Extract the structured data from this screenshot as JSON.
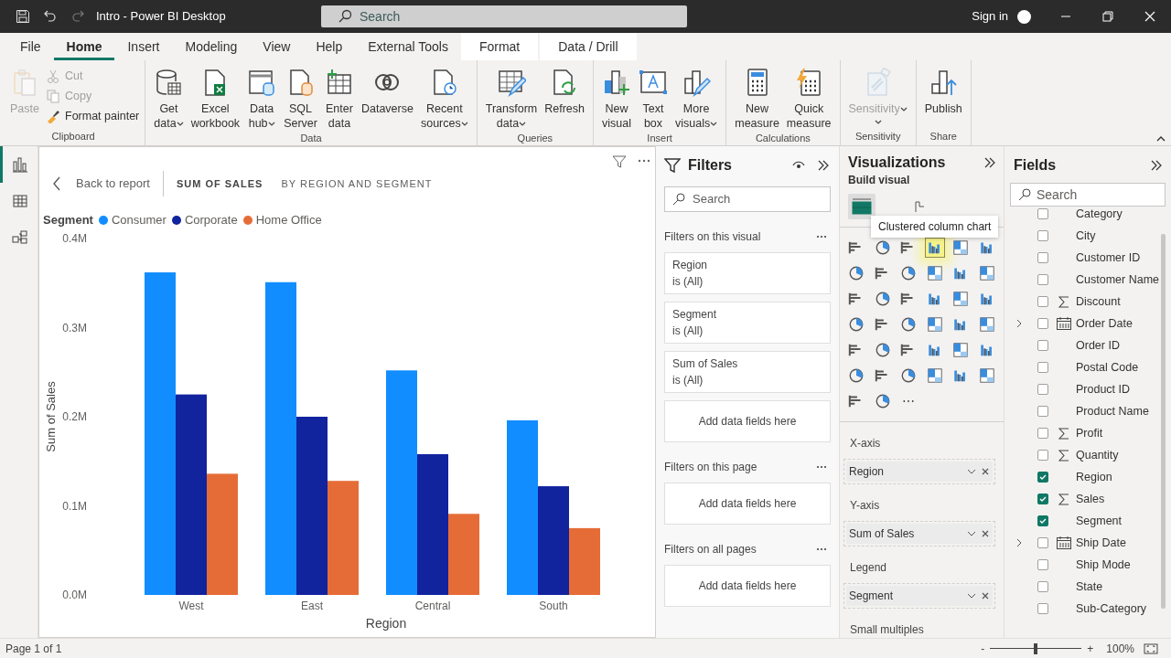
{
  "window": {
    "title": "Intro - Power BI Desktop",
    "search_placeholder": "Search",
    "sign_in": "Sign in"
  },
  "menu_tabs": [
    {
      "label": "File",
      "selected": false,
      "kind": "plain"
    },
    {
      "label": "Home",
      "selected": true,
      "kind": "plain"
    },
    {
      "label": "Insert",
      "selected": false,
      "kind": "plain"
    },
    {
      "label": "Modeling",
      "selected": false,
      "kind": "plain"
    },
    {
      "label": "View",
      "selected": false,
      "kind": "plain"
    },
    {
      "label": "Help",
      "selected": false,
      "kind": "plain"
    },
    {
      "label": "External Tools",
      "selected": false,
      "kind": "plain"
    },
    {
      "label": "Format",
      "selected": false,
      "kind": "contextual"
    },
    {
      "label": "Data / Drill",
      "selected": false,
      "kind": "contextual"
    }
  ],
  "ribbon": {
    "groups": [
      {
        "label": "Clipboard",
        "buttons": [
          {
            "lines": [
              "Paste"
            ],
            "kind": "large",
            "disabled": true,
            "dropdown": false
          },
          {
            "lines": [
              "Cut"
            ],
            "kind": "small",
            "disabled": true
          },
          {
            "lines": [
              "Copy"
            ],
            "kind": "small",
            "disabled": true
          },
          {
            "lines": [
              "Format painter"
            ],
            "kind": "small",
            "disabled": false
          }
        ]
      },
      {
        "label": "Data",
        "buttons": [
          {
            "lines": [
              "Get",
              "data"
            ],
            "kind": "large",
            "disabled": false,
            "dropdown": true
          },
          {
            "lines": [
              "Excel",
              "workbook"
            ],
            "kind": "large",
            "disabled": false,
            "dropdown": false
          },
          {
            "lines": [
              "Data",
              "hub"
            ],
            "kind": "large",
            "disabled": false,
            "dropdown": true
          },
          {
            "lines": [
              "SQL",
              "Server"
            ],
            "kind": "large",
            "disabled": false,
            "dropdown": false
          },
          {
            "lines": [
              "Enter",
              "data"
            ],
            "kind": "large",
            "disabled": false,
            "dropdown": false
          },
          {
            "lines": [
              "Dataverse"
            ],
            "kind": "large",
            "disabled": false,
            "dropdown": false
          },
          {
            "lines": [
              "Recent",
              "sources"
            ],
            "kind": "large",
            "disabled": false,
            "dropdown": true
          }
        ]
      },
      {
        "label": "Queries",
        "buttons": [
          {
            "lines": [
              "Transform",
              "data"
            ],
            "kind": "large",
            "disabled": false,
            "dropdown": true
          },
          {
            "lines": [
              "Refresh"
            ],
            "kind": "large",
            "disabled": false,
            "dropdown": false
          }
        ]
      },
      {
        "label": "Insert",
        "buttons": [
          {
            "lines": [
              "New",
              "visual"
            ],
            "kind": "large",
            "disabled": false,
            "dropdown": false
          },
          {
            "lines": [
              "Text",
              "box"
            ],
            "kind": "large",
            "disabled": false,
            "dropdown": false
          },
          {
            "lines": [
              "More",
              "visuals"
            ],
            "kind": "large",
            "disabled": false,
            "dropdown": true
          }
        ]
      },
      {
        "label": "Calculations",
        "buttons": [
          {
            "lines": [
              "New",
              "measure"
            ],
            "kind": "large",
            "disabled": false,
            "dropdown": false
          },
          {
            "lines": [
              "Quick",
              "measure"
            ],
            "kind": "large",
            "disabled": false,
            "dropdown": false
          }
        ]
      },
      {
        "label": "Sensitivity",
        "buttons": [
          {
            "lines": [
              "Sensitivity"
            ],
            "kind": "large",
            "disabled": true,
            "dropdown": true
          }
        ]
      },
      {
        "label": "Share",
        "buttons": [
          {
            "lines": [
              "Publish"
            ],
            "kind": "large",
            "disabled": false,
            "dropdown": false
          }
        ]
      }
    ]
  },
  "left_nav": [
    {
      "selected": true
    },
    {
      "selected": false
    },
    {
      "selected": false
    }
  ],
  "visual_header": {
    "back": "Back to report",
    "title": "SUM OF SALES",
    "subtitle": "BY REGION AND SEGMENT"
  },
  "chart": {
    "legend_title": "Segment",
    "chart_data": {
      "type": "bar",
      "xlabel": "Region",
      "ylabel": "Sum of Sales",
      "categories": [
        "West",
        "East",
        "Central",
        "South"
      ],
      "series": [
        {
          "name": "Consumer",
          "color": "#118dff",
          "values": [
            362000,
            351000,
            252000,
            196000
          ]
        },
        {
          "name": "Corporate",
          "color": "#12239e",
          "values": [
            225000,
            200000,
            158000,
            122000
          ]
        },
        {
          "name": "Home Office",
          "color": "#e66c37",
          "values": [
            136000,
            128000,
            91000,
            75000
          ]
        }
      ],
      "ylim": [
        0,
        400000
      ],
      "yticks": [
        {
          "value": 0,
          "label": "0.0M"
        },
        {
          "value": 100000,
          "label": "0.1M"
        },
        {
          "value": 200000,
          "label": "0.2M"
        },
        {
          "value": 300000,
          "label": "0.3M"
        },
        {
          "value": 400000,
          "label": "0.4M"
        }
      ]
    }
  },
  "filters": {
    "title": "Filters",
    "search_placeholder": "Search",
    "sections": [
      {
        "label": "Filters on this visual",
        "cards": [
          {
            "field": "Region",
            "state": "is (All)"
          },
          {
            "field": "Segment",
            "state": "is (All)"
          },
          {
            "field": "Sum of Sales",
            "state": "is (All)"
          }
        ],
        "drop": "Add data fields here"
      },
      {
        "label": "Filters on this page",
        "drop": "Add data fields here"
      },
      {
        "label": "Filters on all pages",
        "drop": "Add data fields here"
      }
    ]
  },
  "visualizations": {
    "title": "Visualizations",
    "subtitle": "Build visual",
    "tooltip": "Clustered column chart",
    "more": "⋯",
    "wells": [
      {
        "label": "X-axis",
        "value": "Region"
      },
      {
        "label": "Y-axis",
        "value": "Sum of Sales"
      },
      {
        "label": "Legend",
        "value": "Segment"
      },
      {
        "label": "Small multiples"
      }
    ]
  },
  "fields": {
    "title": "Fields",
    "search_placeholder": "Search",
    "items": [
      {
        "name": "Category",
        "checked": false,
        "kind": "text",
        "expandable": false
      },
      {
        "name": "City",
        "checked": false,
        "kind": "text",
        "expandable": false
      },
      {
        "name": "Customer ID",
        "checked": false,
        "kind": "text",
        "expandable": false
      },
      {
        "name": "Customer Name",
        "checked": false,
        "kind": "text",
        "expandable": false
      },
      {
        "name": "Discount",
        "checked": false,
        "kind": "sum",
        "expandable": false
      },
      {
        "name": "Order Date",
        "checked": false,
        "kind": "date",
        "expandable": true
      },
      {
        "name": "Order ID",
        "checked": false,
        "kind": "text",
        "expandable": false
      },
      {
        "name": "Postal Code",
        "checked": false,
        "kind": "text",
        "expandable": false
      },
      {
        "name": "Product ID",
        "checked": false,
        "kind": "text",
        "expandable": false
      },
      {
        "name": "Product Name",
        "checked": false,
        "kind": "text",
        "expandable": false
      },
      {
        "name": "Profit",
        "checked": false,
        "kind": "sum",
        "expandable": false
      },
      {
        "name": "Quantity",
        "checked": false,
        "kind": "sum",
        "expandable": false
      },
      {
        "name": "Region",
        "checked": true,
        "kind": "text",
        "expandable": false
      },
      {
        "name": "Sales",
        "checked": true,
        "kind": "sum",
        "expandable": false
      },
      {
        "name": "Segment",
        "checked": true,
        "kind": "text",
        "expandable": false
      },
      {
        "name": "Ship Date",
        "checked": false,
        "kind": "date",
        "expandable": true
      },
      {
        "name": "Ship Mode",
        "checked": false,
        "kind": "text",
        "expandable": false
      },
      {
        "name": "State",
        "checked": false,
        "kind": "text",
        "expandable": false
      },
      {
        "name": "Sub-Category",
        "checked": false,
        "kind": "text",
        "expandable": false
      }
    ]
  },
  "status_bar": {
    "page": "Page 1 of 1",
    "zoom_minus": "-",
    "zoom_plus": "+",
    "zoom": "100%",
    "zoom_slider": {
      "level": 0.5
    }
  }
}
